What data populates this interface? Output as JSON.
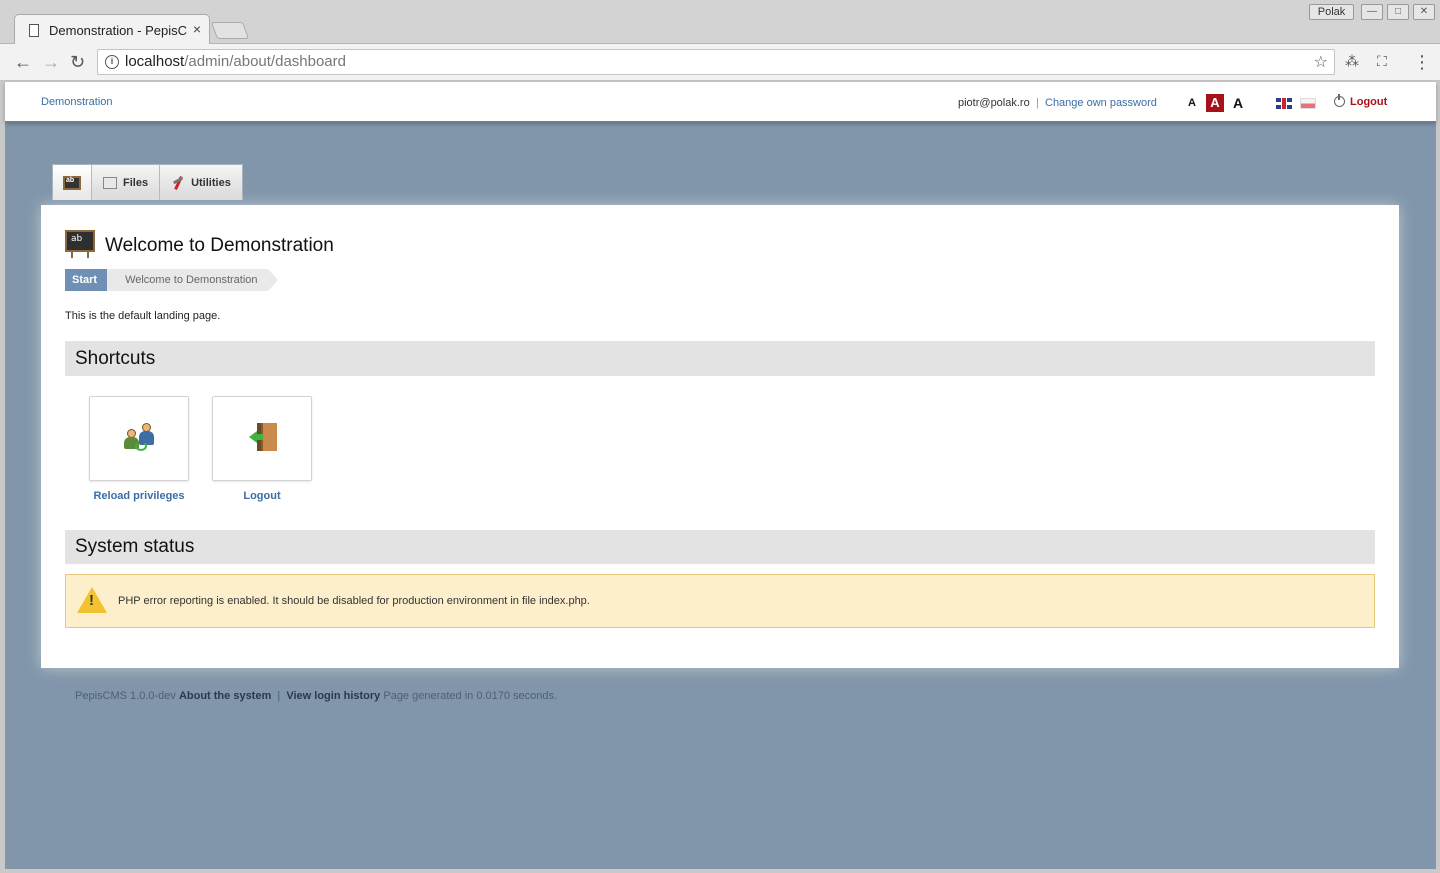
{
  "browser": {
    "tab_title": "Demonstration - PepisC",
    "tab_close": "×",
    "profile_name": "Polak",
    "window_min": "—",
    "window_max": "□",
    "window_close": "✕",
    "url_host": "localhost",
    "url_path": "/admin/about/dashboard",
    "nav_back": "←",
    "nav_forward": "→",
    "nav_reload": "↻",
    "menu": "⋮"
  },
  "header": {
    "site_name": "Demonstration",
    "user_email": "piotr@polak.ro",
    "separator": "|",
    "change_password": "Change own password",
    "font_sizes": [
      "A",
      "A",
      "A"
    ],
    "logout": "Logout"
  },
  "menu": {
    "items": [
      {
        "label": ""
      },
      {
        "label": "Files"
      },
      {
        "label": "Utilities"
      }
    ]
  },
  "main": {
    "title": "Welcome to Demonstration",
    "board_text": "ab",
    "breadcrumb": [
      "Start",
      "Welcome to Demonstration"
    ],
    "intro": "This is the default landing page.",
    "shortcuts_title": "Shortcuts",
    "shortcuts": [
      {
        "label": "Reload privileges"
      },
      {
        "label": "Logout"
      }
    ],
    "status_title": "System status",
    "warning": "PHP error reporting is enabled. It should be disabled for production environment in file index.php."
  },
  "footer": {
    "version": "PepisCMS 1.0.0-dev",
    "about": "About the system",
    "separator": "|",
    "login_history": "View login history",
    "generated": "Page generated in 0.0170 seconds."
  },
  "colors": {
    "page_background": "#8196aa",
    "link": "#3a6ea5",
    "logout": "#a8111a",
    "breadcrumb_start": "#6f8fb5",
    "warning_bg": "#fdefcb"
  }
}
